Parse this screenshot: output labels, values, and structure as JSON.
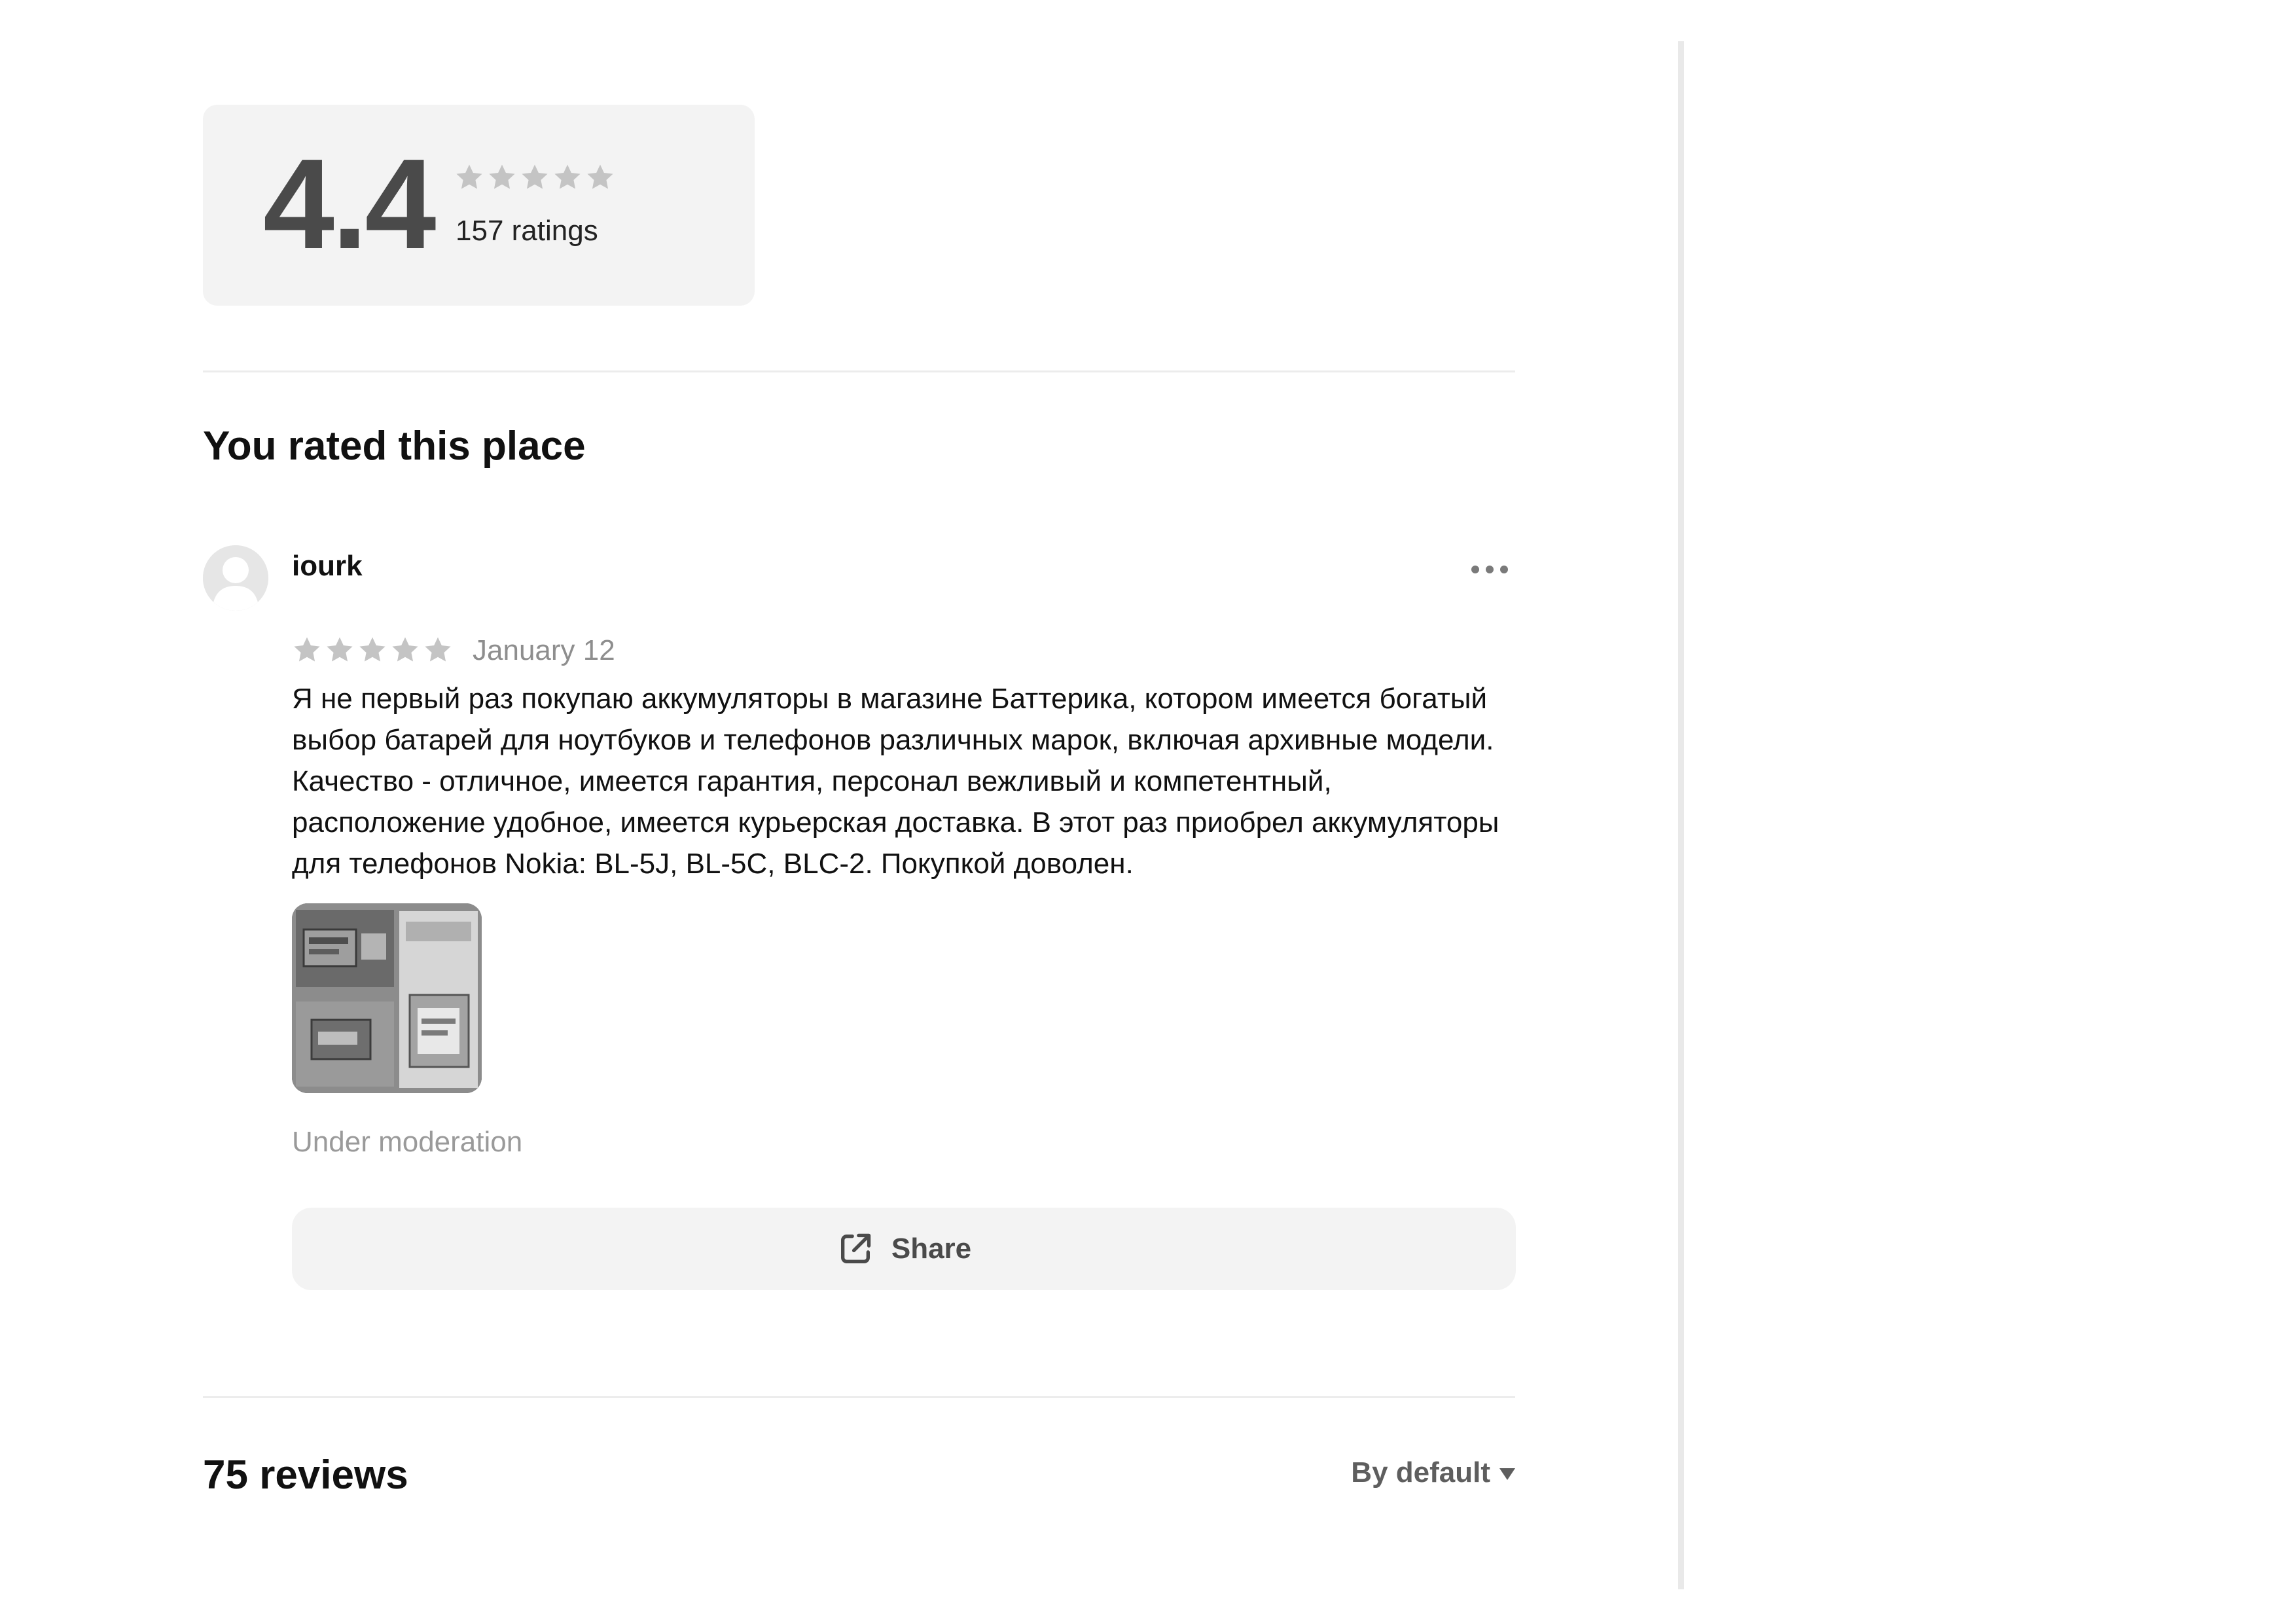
{
  "summary": {
    "rating_value": "4.4",
    "stars_filled": 0,
    "stars_total": 5,
    "ratings_count": "157 ratings"
  },
  "my_review": {
    "section_title": "You rated this place",
    "username": "iourk",
    "stars_filled": 0,
    "stars_total": 5,
    "date": "January 12",
    "text": "Я не первый раз покупаю аккумуляторы в магазине Баттерика, котором имеется богатый\nвыбор батарей для ноутбуков и телефонов различных марок, включая архивные модели.\nКачество - отличное, имеется гарантия, персонал вежливый и компетентный,\nрасположение удобное, имеется курьерская доставка. В этот раз приобрел аккумуляторы\nдля телефонов Nokia: BL-5J, BL-5C, BLC-2. Покупкой доволен.",
    "status": "Under moderation",
    "share_label": "Share",
    "more_icon": "more-dots-icon",
    "share_icon": "external-link-icon"
  },
  "reviews_header": {
    "title": "75 reviews",
    "sort_label": "By default"
  },
  "colors": {
    "card_bg": "#f3f3f3",
    "star_empty": "#c4c4c4",
    "muted_text": "#9a9a9a",
    "divider": "#ececec"
  }
}
